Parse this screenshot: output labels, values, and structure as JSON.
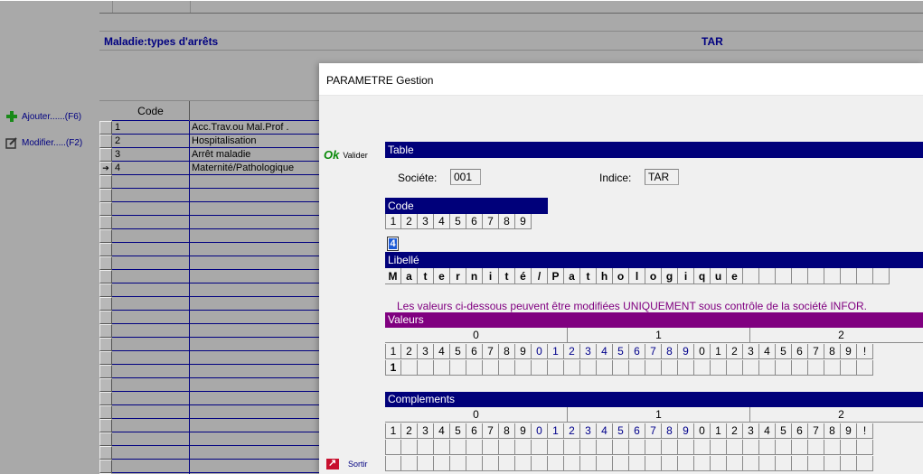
{
  "background": {
    "table_title": "Maladie:types d'arrêts",
    "table_code": "TAR",
    "sidebar": {
      "add_label": "Ajouter......(F6)",
      "modify_label": "Modifier.....(F2)"
    },
    "grid": {
      "header_code": "Code",
      "rows": [
        {
          "code": "1",
          "label": "Acc.Trav.ou Mal.Prof ."
        },
        {
          "code": "2",
          "label": "Hospitalisation"
        },
        {
          "code": "3",
          "label": "Arrêt maladie"
        },
        {
          "code": "4",
          "label": "Maternité/Pathologique"
        }
      ],
      "current_marker": "➔"
    }
  },
  "dialog": {
    "title": "PARAMETRE Gestion",
    "ok_icon": "Ok",
    "ok_label": "Valider",
    "exit_label": "Sortir",
    "table_section": "Table",
    "societe_label": "Sociéte:",
    "societe_value": "001",
    "indice_label": "Indice:",
    "indice_value": "TAR",
    "code_section": "Code",
    "code_digits": [
      "1",
      "2",
      "3",
      "4",
      "5",
      "6",
      "7",
      "8",
      "9"
    ],
    "code_value": "4",
    "libelle_section": "Libellé",
    "libelle_chars": [
      "M",
      "a",
      "t",
      "e",
      "r",
      "n",
      "i",
      "t",
      "é",
      "/",
      "P",
      "a",
      "t",
      "h",
      "o",
      "l",
      "o",
      "g",
      "i",
      "q",
      "u",
      "e",
      "",
      "",
      "",
      "",
      "",
      "",
      "",
      "",
      ""
    ],
    "warning": "Les valeurs ci-dessous peuvent être modifiées UNIQUEMENT sous contrôle de la société INFOR.",
    "valeurs_section": "Valeurs",
    "complements_section": "Complements",
    "group_headers": [
      "0",
      "1",
      "2",
      ":"
    ],
    "digit_row": [
      "1",
      "2",
      "3",
      "4",
      "5",
      "6",
      "7",
      "8",
      "9",
      "0",
      "1",
      "2",
      "3",
      "4",
      "5",
      "6",
      "7",
      "8",
      "9",
      "0",
      "1",
      "2",
      "3",
      "4",
      "5",
      "6",
      "7",
      "8",
      "9",
      "!"
    ],
    "valeurs_values": [
      "1"
    ]
  },
  "colors": {
    "section_bar": "#00007a",
    "valeurs_bar": "#800080",
    "warning_text": "#800080",
    "ok_green": "#0a8a0a"
  }
}
